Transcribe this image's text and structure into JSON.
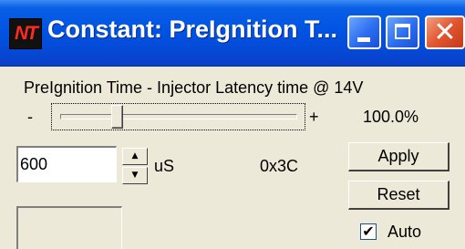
{
  "window": {
    "title": "Constant: PreIgnition T...",
    "icon_text": "NT",
    "icons": {
      "app": "nt-app-icon",
      "minimize": "minimize-icon",
      "maximize": "maximize-icon",
      "close": "close-icon"
    }
  },
  "constant": {
    "label": "PreIgnition Time - Injector Latency time @ 14V",
    "slider_min_label": "-",
    "slider_max_label": "+",
    "percent": "100.0%",
    "slider_position_fraction": 0.24,
    "value": "600",
    "unit": "uS",
    "hex": "0x3C",
    "spin_up_glyph": "▲",
    "spin_down_glyph": "▼"
  },
  "buttons": {
    "apply": "Apply",
    "reset": "Reset"
  },
  "auto": {
    "label": "Auto",
    "checked": true,
    "check_glyph": "✔"
  },
  "colors": {
    "titlebar": "#0054e3",
    "close_button": "#e2552f",
    "window_bg": "#ece9d8",
    "nt_logo": "#ff2a1f"
  }
}
